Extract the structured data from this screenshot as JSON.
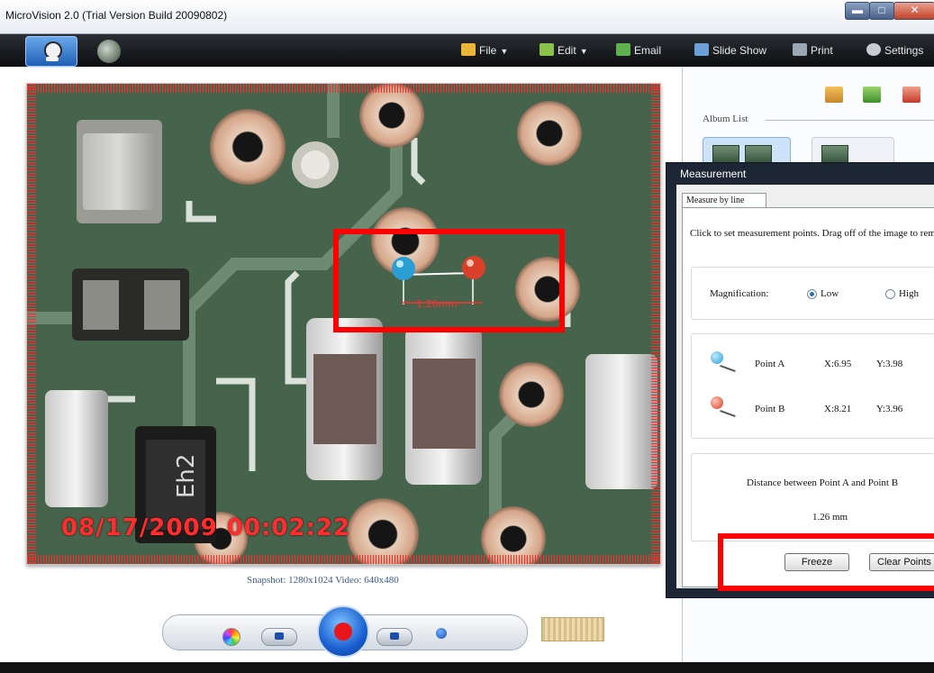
{
  "window": {
    "title": "MicroVision 2.0 (Trial Version Build 20090802)",
    "min_glyph": "▬",
    "max_glyph": "□",
    "close_glyph": "✕"
  },
  "toolbar": {
    "file_label": "File",
    "edit_label": "Edit",
    "email_label": "Email",
    "slideshow_label": "Slide Show",
    "print_label": "Print",
    "settings_label": "Settings",
    "dropdown_glyph": "▼"
  },
  "viewer": {
    "timestamp": "08/17/2009 00:02:22",
    "measurement_label": "1.26mm",
    "caption": "Snapshot: 1280x1024    Video: 640x480"
  },
  "sidebar": {
    "album_list_label": "Album List"
  },
  "measurement_dialog": {
    "title": "Measurement",
    "tab_label": "Measure by line",
    "instructions": "Click to set measurement points. Drag off of the image to remove.",
    "magnification_label": "Magnification:",
    "mag_low": "Low",
    "mag_high": "High",
    "point_a": {
      "label": "Point A",
      "x": "X:6.95",
      "y": "Y:3.98"
    },
    "point_b": {
      "label": "Point B",
      "x": "X:8.21",
      "y": "Y:3.96"
    },
    "distance_label": "Distance between Point A and Point B",
    "distance_value": "1.26 mm",
    "freeze_label": "Freeze",
    "clear_label": "Clear Points"
  },
  "colors": {
    "highlight": "#ff0000",
    "point_a": "#2a9fd6",
    "point_b": "#d9402a",
    "toolbar_bg": "#15171b"
  }
}
